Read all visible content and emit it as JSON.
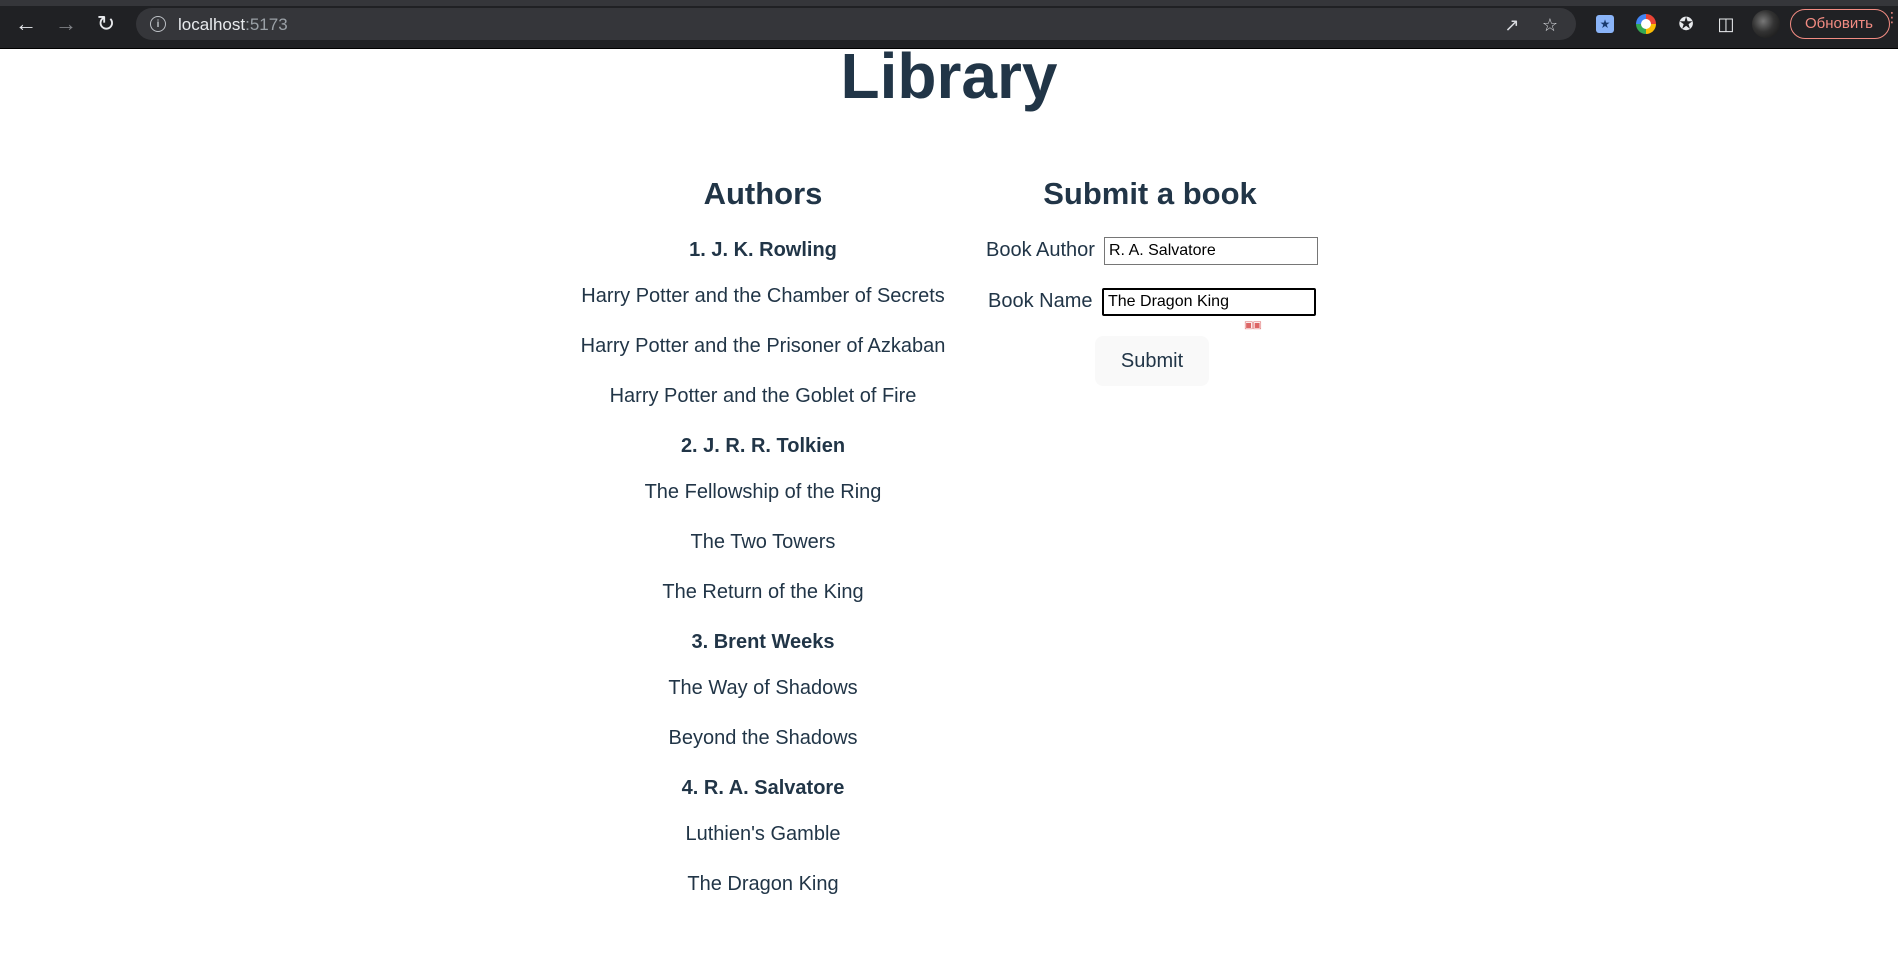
{
  "browser": {
    "url_host": "localhost",
    "url_port": ":5173",
    "update_label": "Обновить"
  },
  "page": {
    "title": "Library"
  },
  "authors_section": {
    "heading": "Authors",
    "authors": [
      {
        "label": "1. J. K. Rowling",
        "books": [
          "Harry Potter and the Chamber of Secrets",
          "Harry Potter and the Prisoner of Azkaban",
          "Harry Potter and the Goblet of Fire"
        ]
      },
      {
        "label": "2. J. R. R. Tolkien",
        "books": [
          "The Fellowship of the Ring",
          "The Two Towers",
          "The Return of the King"
        ]
      },
      {
        "label": "3. Brent Weeks",
        "books": [
          "The Way of Shadows",
          "Beyond the Shadows"
        ]
      },
      {
        "label": "4. R. A. Salvatore",
        "books": [
          "Luthien's Gamble",
          "The Dragon King"
        ]
      }
    ]
  },
  "form": {
    "heading": "Submit a book",
    "author_label": "Book Author",
    "author_value": "R. A. Salvatore",
    "name_label": "Book Name",
    "name_value": "The Dragon King",
    "submit_label": "Submit"
  }
}
